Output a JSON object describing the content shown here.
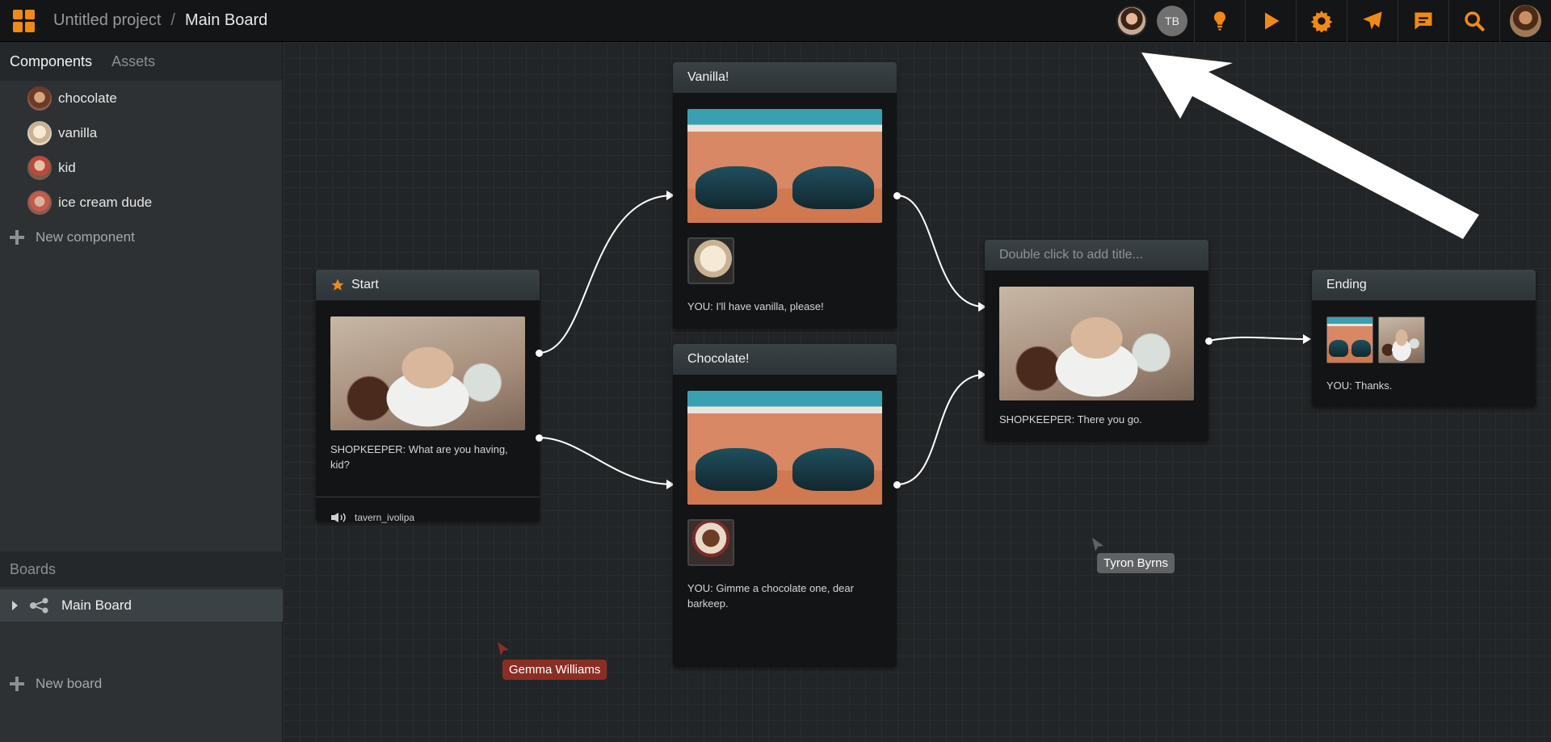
{
  "header": {
    "project_name": "Untitled project",
    "separator": "/",
    "board_name": "Main Board",
    "collaborator_initials": "TB",
    "tools": [
      "lightbulb-icon",
      "play-icon",
      "gear-icon",
      "send-icon",
      "chat-icon",
      "search-icon"
    ],
    "accent": "#f08a16"
  },
  "sidebar": {
    "tabs": [
      {
        "label": "Components"
      },
      {
        "label": "Assets"
      }
    ],
    "components": [
      {
        "label": "chocolate"
      },
      {
        "label": "vanilla"
      },
      {
        "label": "kid"
      },
      {
        "label": "ice cream dude"
      }
    ],
    "new_component_label": "New component",
    "boards_header": "Boards",
    "boards": [
      {
        "label": "Main Board"
      }
    ],
    "new_board_label": "New board"
  },
  "nodes": {
    "start": {
      "title": "Start",
      "dialogue": "SHOPKEEPER: What are you having, kid?",
      "audio": "tavern_ivolipa"
    },
    "vanilla": {
      "title": "Vanilla!",
      "dialogue": "YOU: I'll have vanilla, please!"
    },
    "chocolate": {
      "title": "Chocolate!",
      "dialogue_line1": "YOU: Gimme a chocolate one, dear",
      "dialogue_line2": "barkeep."
    },
    "middle": {
      "title_placeholder": "Double click to add title...",
      "dialogue": "SHOPKEEPER: There you go."
    },
    "ending": {
      "title": "Ending",
      "dialogue": "YOU: Thanks."
    }
  },
  "cursors": [
    {
      "name": "Tyron Byrns",
      "color": "#5f6264"
    },
    {
      "name": "Gemma Williams",
      "color": "#8a2e25"
    }
  ]
}
